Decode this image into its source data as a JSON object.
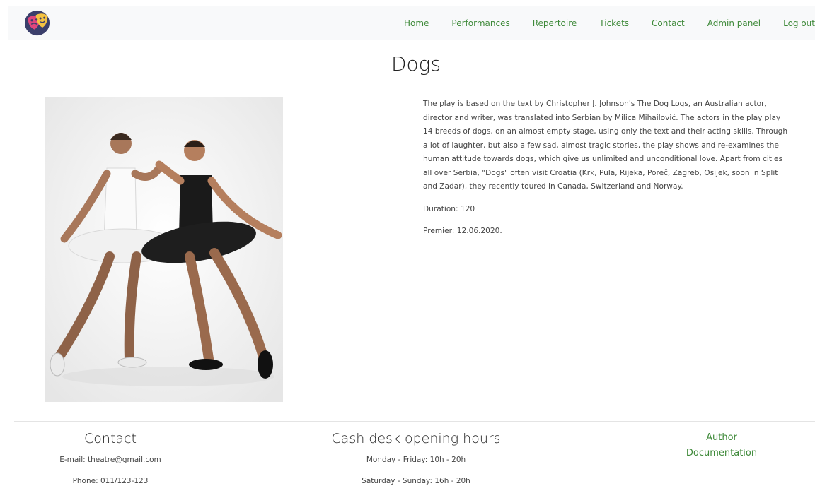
{
  "nav": {
    "items": [
      "Home",
      "Performances",
      "Repertoire",
      "Tickets",
      "Contact",
      "Admin panel",
      "Log out"
    ]
  },
  "colors": {
    "link": "#3f8a3a",
    "navbar_bg": "#f8f9fa",
    "logo_circle": "#3b3f6b",
    "mask_pink": "#e0467c",
    "mask_yellow": "#f5c342"
  },
  "play": {
    "title": "Dogs",
    "description": "The play is based on the text by Christopher J. Johnson's The Dog Logs, an Australian actor, director and writer, was translated into Serbian by Milica Mihailović. The actors in the play play 14 breeds of dogs, on an almost empty stage, using only the text and their acting skills. Through a lot of laughter, but also a few sad, almost tragic stories, the play shows and re-examines the human attitude towards dogs, which give us unlimited and unconditional love. Apart from cities all over Serbia, \"Dogs\" often visit Croatia (Krk, Pula, Rijeka, Poreč, Zagreb, Osijek, soon in Split and Zadar), they recently toured in Canada, Switzerland and Norway.",
    "duration": "Duration: 120",
    "premier": "Premier: 12.06.2020."
  },
  "footer": {
    "contact": {
      "title": "Contact",
      "email": "E-mail: theatre@gmail.com",
      "phone": "Phone: 011/123-123"
    },
    "hours": {
      "title": "Cash desk opening hours",
      "weekdays": "Monday - Friday: 10h - 20h",
      "weekend": "Saturday - Sunday: 16h - 20h"
    },
    "links": {
      "author": "Author",
      "documentation": "Documentation"
    }
  }
}
